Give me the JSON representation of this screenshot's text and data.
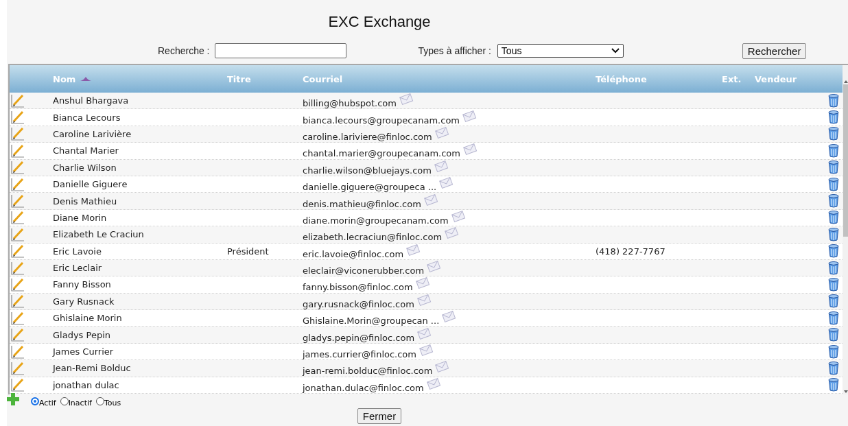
{
  "title": "EXC Exchange",
  "search": {
    "label": "Recherche :"
  },
  "types": {
    "label": "Types à afficher :",
    "value": "Tous"
  },
  "search_button": "Rechercher",
  "columns": [
    {
      "label": "Nom",
      "sorted": true
    },
    {
      "label": "Titre",
      "sorted": false
    },
    {
      "label": "Courriel",
      "sorted": false
    },
    {
      "label": "Téléphone",
      "sorted": false
    },
    {
      "label": "Ext.",
      "sorted": false
    },
    {
      "label": "Vendeur",
      "sorted": false
    }
  ],
  "rows": [
    {
      "name": "Anshul Bhargava",
      "email": "billing@hubspot.com"
    },
    {
      "name": "Bianca Lecours",
      "email": "bianca.lecours@groupecanam.com"
    },
    {
      "name": "Caroline Larivière",
      "email": "caroline.lariviere@finloc.com"
    },
    {
      "name": "Chantal Marier",
      "email": "chantal.marier@groupecanam.com"
    },
    {
      "name": "Charlie Wilson",
      "email": "charlie.wilson@bluejays.com"
    },
    {
      "name": "Danielle Giguere",
      "email": "danielle.giguere@groupeca ..."
    },
    {
      "name": "Denis Mathieu",
      "email": "denis.mathieu@finloc.com"
    },
    {
      "name": "Diane Morin",
      "email": "diane.morin@groupecanam.com"
    },
    {
      "name": "Elizabeth Le Craciun",
      "email": "elizabeth.lecraciun@finloc.com"
    },
    {
      "name": "Eric Lavoie",
      "title": "Président",
      "email": "eric.lavoie@finloc.com",
      "phone": "(418) 227-7767"
    },
    {
      "name": "Eric Leclair",
      "email": "eleclair@viconerubber.com"
    },
    {
      "name": "Fanny Bisson",
      "email": "fanny.bisson@finloc.com"
    },
    {
      "name": "Gary Rusnack",
      "email": "gary.rusnack@finloc.com"
    },
    {
      "name": "Ghislaine Morin",
      "email": "Ghislaine.Morin@groupecan ..."
    },
    {
      "name": "Gladys Pepin",
      "email": "gladys.pepin@finloc.com"
    },
    {
      "name": "James Currier",
      "email": "james.currier@finloc.com"
    },
    {
      "name": "Jean-Remi Bolduc",
      "email": "jean-remi.bolduc@finloc.com"
    },
    {
      "name": "jonathan dulac",
      "email": "jonathan.dulac@finloc.com"
    }
  ],
  "filters": [
    {
      "label": "Actif",
      "selected": true
    },
    {
      "label": "Inactif",
      "selected": false
    },
    {
      "label": "Tous",
      "selected": false
    }
  ],
  "close_button": "Fermer"
}
